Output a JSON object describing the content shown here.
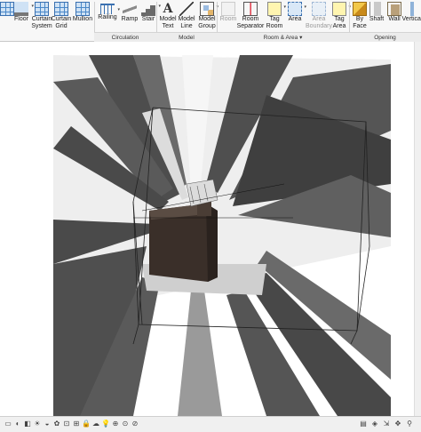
{
  "ribbon": {
    "buttons": [
      {
        "id": "grid",
        "label": "",
        "icon": "grid-icon"
      },
      {
        "id": "floor",
        "label": "Floor",
        "icon": "floor-icon",
        "caret": true
      },
      {
        "id": "curtain_system",
        "label": "Curtain\nSystem",
        "icon": "curtain-system-icon"
      },
      {
        "id": "curtain_grid",
        "label": "Curtain\nGrid",
        "icon": "curtain-grid-icon"
      },
      {
        "id": "mullion",
        "label": "Mullion",
        "icon": "mullion-icon"
      },
      {
        "id": "railing",
        "label": "Railing",
        "icon": "railing-icon",
        "caret": true
      },
      {
        "id": "ramp",
        "label": "Ramp",
        "icon": "ramp-icon"
      },
      {
        "id": "stair",
        "label": "Stair",
        "icon": "stair-icon",
        "caret": true
      },
      {
        "id": "model_text",
        "label": "Model\nText",
        "icon": "model-text-icon"
      },
      {
        "id": "model_line",
        "label": "Model\nLine",
        "icon": "model-line-icon"
      },
      {
        "id": "model_group",
        "label": "Model\nGroup",
        "icon": "model-group-icon",
        "caret": true
      },
      {
        "id": "room",
        "label": "Room",
        "icon": "room-icon",
        "disabled": true
      },
      {
        "id": "room_separator",
        "label": "Room\nSeparator",
        "icon": "room-separator-icon"
      },
      {
        "id": "tag_room",
        "label": "Tag\nRoom",
        "icon": "tag-room-icon",
        "caret": true
      },
      {
        "id": "area",
        "label": "Area",
        "icon": "area-icon",
        "caret": true
      },
      {
        "id": "area_boundary",
        "label": "Area\nBoundary",
        "icon": "area-boundary-icon",
        "disabled": true
      },
      {
        "id": "tag_area",
        "label": "Tag\nArea",
        "icon": "tag-area-icon",
        "caret": true
      },
      {
        "id": "by_face",
        "label": "By\nFace",
        "icon": "by-face-icon"
      },
      {
        "id": "shaft",
        "label": "Shaft",
        "icon": "shaft-icon"
      },
      {
        "id": "wall",
        "label": "Wall",
        "icon": "wall-opening-icon"
      },
      {
        "id": "vertical",
        "label": "Vertical",
        "icon": "vertical-opening-icon"
      }
    ],
    "panels": {
      "circulation": "Circulation",
      "model": "Model",
      "room_area": "Room & Area ▾",
      "opening": "Opening"
    }
  },
  "statusbar": {
    "icons": [
      "view-scale-icon",
      "detail-level-icon",
      "visual-style-icon",
      "sun-path-icon",
      "shadows-icon",
      "render-icon",
      "crop-icon",
      "show-crop-icon",
      "lock-3d-icon",
      "temporary-hide-icon",
      "reveal-hidden-icon",
      "analytical-model-icon",
      "highlight-displacement-icon",
      "constraints-icon"
    ],
    "right_icons": [
      "worksets-icon",
      "design-options-icon",
      "selection-filter-icon",
      "press-drag-icon",
      "filter-icon"
    ]
  },
  "colors": {
    "ribbon_bg": "#f7f7f7",
    "shadow_dark": "#4a4a4a",
    "shadow_light": "#d6d6d6",
    "building": "#3a2f29"
  }
}
